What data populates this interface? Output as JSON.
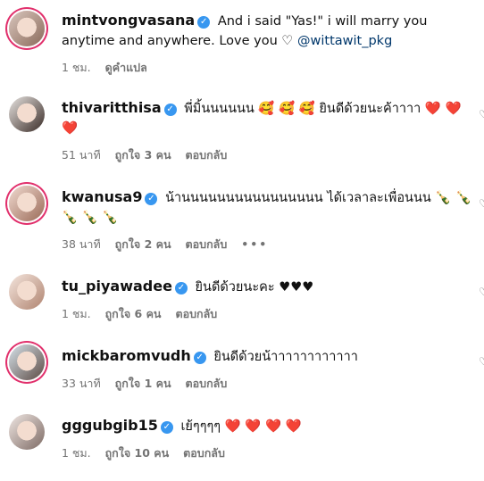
{
  "comments": [
    {
      "username": "mintvongvasana",
      "text": "And i said \"Yas!\" i will marry you anytime and anywhere. Love you",
      "heart": "♡",
      "mention": "@wittawit_pkg",
      "time": "1 ชม.",
      "action1": "ดูคำแปล"
    },
    {
      "username": "thivaritthisa",
      "text": "พี่มิ้นนนนนน 🥰 🥰 🥰  ยินดีด้วยนะค้าาาา ❤️ ❤️ ❤️",
      "time": "51 นาที",
      "likes": "ถูกใจ 3 คน",
      "reply": "ตอบกลับ"
    },
    {
      "username": "kwanusa9",
      "text": "น้านนนนนนนนนนนนนนนน ได้เวลาละเพื่อนนน 🍾 🍾 🍾 🍾 🍾",
      "time": "38 นาที",
      "likes": "ถูกใจ 2 คน",
      "reply": "ตอบกลับ",
      "more": "•••"
    },
    {
      "username": "tu_piyawadee",
      "text": "ยินดีด้วยนะคะ ♥♥♥",
      "time": "1 ชม.",
      "likes": "ถูกใจ 6 คน",
      "reply": "ตอบกลับ"
    },
    {
      "username": "mickbaromvudh",
      "text": "ยินดีด้วยน้าาาาาาาาาาาา",
      "time": "33 นาที",
      "likes": "ถูกใจ 1 คน",
      "reply": "ตอบกลับ"
    },
    {
      "username": "gggubgib15",
      "text": "เย้ๆๆๆๆ ❤️ ❤️ ❤️ ❤️",
      "time": "1 ชม.",
      "likes": "ถูกใจ 10 คน",
      "reply": "ตอบกลับ"
    }
  ]
}
